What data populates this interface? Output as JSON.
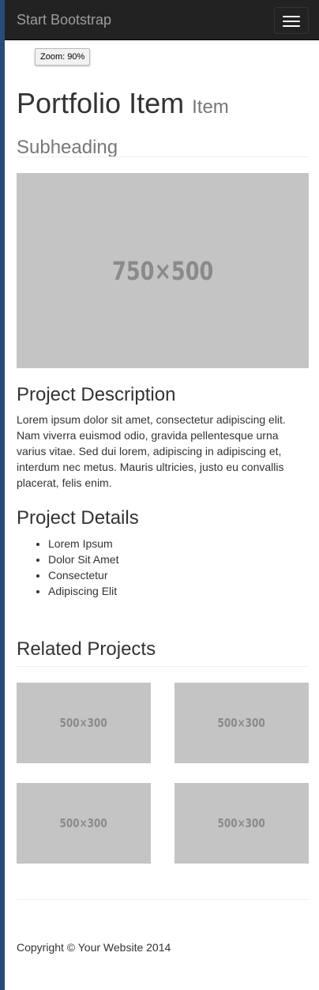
{
  "navbar": {
    "brand": "Start Bootstrap",
    "toggle_icon": "hamburger-menu-icon"
  },
  "zoom_badge": "Zoom: 90%",
  "header": {
    "title": "Portfolio Item",
    "subtitle": "Item Subheading"
  },
  "main_image": {
    "label": "750×500"
  },
  "description": {
    "title": "Project Description",
    "text": "Lorem ipsum dolor sit amet, consectetur adipiscing elit. Nam viverra euismod odio, gravida pellentesque urna varius vitae. Sed dui lorem, adipiscing in adipiscing et, interdum nec metus. Mauris ultricies, justo eu convallis placerat, felis enim."
  },
  "details": {
    "title": "Project Details",
    "items": [
      "Lorem Ipsum",
      "Dolor Sit Amet",
      "Consectetur",
      "Adipiscing Elit"
    ]
  },
  "related": {
    "title": "Related Projects",
    "thumbs": [
      "500×300",
      "500×300",
      "500×300",
      "500×300"
    ]
  },
  "footer": {
    "copyright": "Copyright © Your Website 2014"
  },
  "colors": {
    "navbar_bg": "#222222",
    "brand_text": "#9d9d9d",
    "placeholder_bg": "#c4c4c4",
    "placeholder_text": "#8a8a8a"
  }
}
